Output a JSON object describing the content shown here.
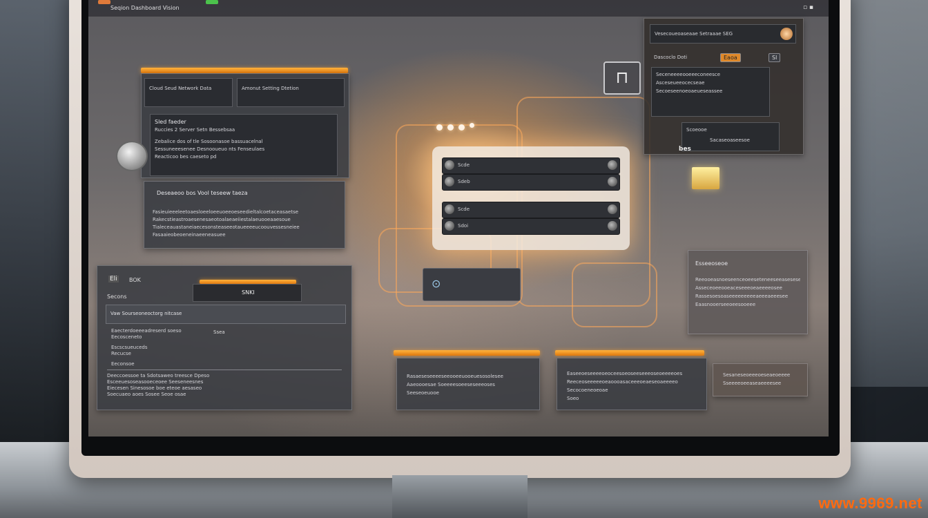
{
  "topbar": {
    "title": "Seqion Dashboard Vision"
  },
  "left_top_panel": {
    "tab_a": "Cloud Seud Network Data",
    "tab_b": "Amonut Setting Dtetion",
    "section_title": "Sled faeder",
    "subtitle": "Ruccies 2 Server Setn Bessebsaa",
    "lines": [
      "Zebalice dos of tle Sosoonasoe bassuacelnal",
      "Sessuneeesenee Desnooueuo nts Fenseulaes",
      "Reacticoo bes caeseto pd"
    ]
  },
  "left_mid_panel": {
    "heading": "Deseaeoo bos   Vool teseew taeza",
    "lines": [
      "Fasieuieeeleetoaesloeeloeeuoeeoeseedieltalcoetaceasaetse",
      "Rakecstieastroaesenesaeotoalaeaeiiestalaeuooeaaesoue",
      "Tialeceauastaneiaecesonsteaseeotaueeeeucoouvessesneiee",
      "Fasaaieobeoeneinaeeneasuee"
    ]
  },
  "left_bottom_panel": {
    "tag": "Eli",
    "tag2": "BOK",
    "label": "Secons",
    "field": "SNKI",
    "search": "Vaw Sourseoneoctorg nitcase",
    "rows": [
      "Eaecterdoeeeadreserd soeso",
      "Eecosceneto",
      "Escscsueuceds",
      "Recucse",
      "Eeconsoe",
      "Deeccoessoe ta Sdotsaweo treesce  Dpeso",
      "Esceeuesoseasooeceoee Seeseneesnes",
      "Eiecesen Sinesosoe boe eteoe aesaseo",
      "Soecuaeo aoes Sosee Seoe osae"
    ],
    "status": "Ssea"
  },
  "center": {
    "slots": [
      "Scde",
      "Sdeb",
      "Scde",
      "Sdoi"
    ],
    "button_label": "⊙"
  },
  "top_right_panel": {
    "header": "Vesecoueoaseaae Setraaae  SEG",
    "sub": "Dascoclo Doti",
    "badge": "Eaoa",
    "badge2": "Sl",
    "lines": [
      "Seceneeeeooeeeconeesce",
      "Asceseueeocecseae",
      "Secoeseenoeoaeueseassee"
    ],
    "footer_a": "Scoeooe",
    "footer_b": "bes",
    "footer_c": "Sacaseoaseesoe"
  },
  "right_mid_panel": {
    "heading": "Esseeoseoe",
    "lines": [
      "Reeooeasnoeseenceoeeseteneeseeaseseseo",
      "Asseceoeeooeaceseeeoeaeeeeosee",
      "Rassesoesoaseeeeeeeeeaeeeaeeesee",
      "Eaasnooerseeoeesooeee"
    ]
  },
  "bottom_cards": [
    {
      "lines": [
        "Rasaeseseeeeseeooeeuooeuesosolesee",
        "Aaeoooesae Soeeeesoeeseseeeoses",
        "Seeseoeuooe"
      ]
    },
    {
      "lines": [
        "Easeeoeseeeeoeoceesoeoseeseeeoseoeeeeoes",
        "Reeceoseeeeeoeaoooasaceeeoeaeseoaeeeeo",
        "Secocoeneoeoae",
        "Soeo"
      ]
    },
    {
      "lines": [
        "Sesaneseoeeeoeseaeoeeee",
        "Sseeeeoeeaseaeeeesee"
      ]
    }
  ],
  "watermark": "www.9969.net",
  "colors": {
    "accent": "#f2a23a",
    "glow": "#ffc27a",
    "panel": "#3a3c42"
  }
}
